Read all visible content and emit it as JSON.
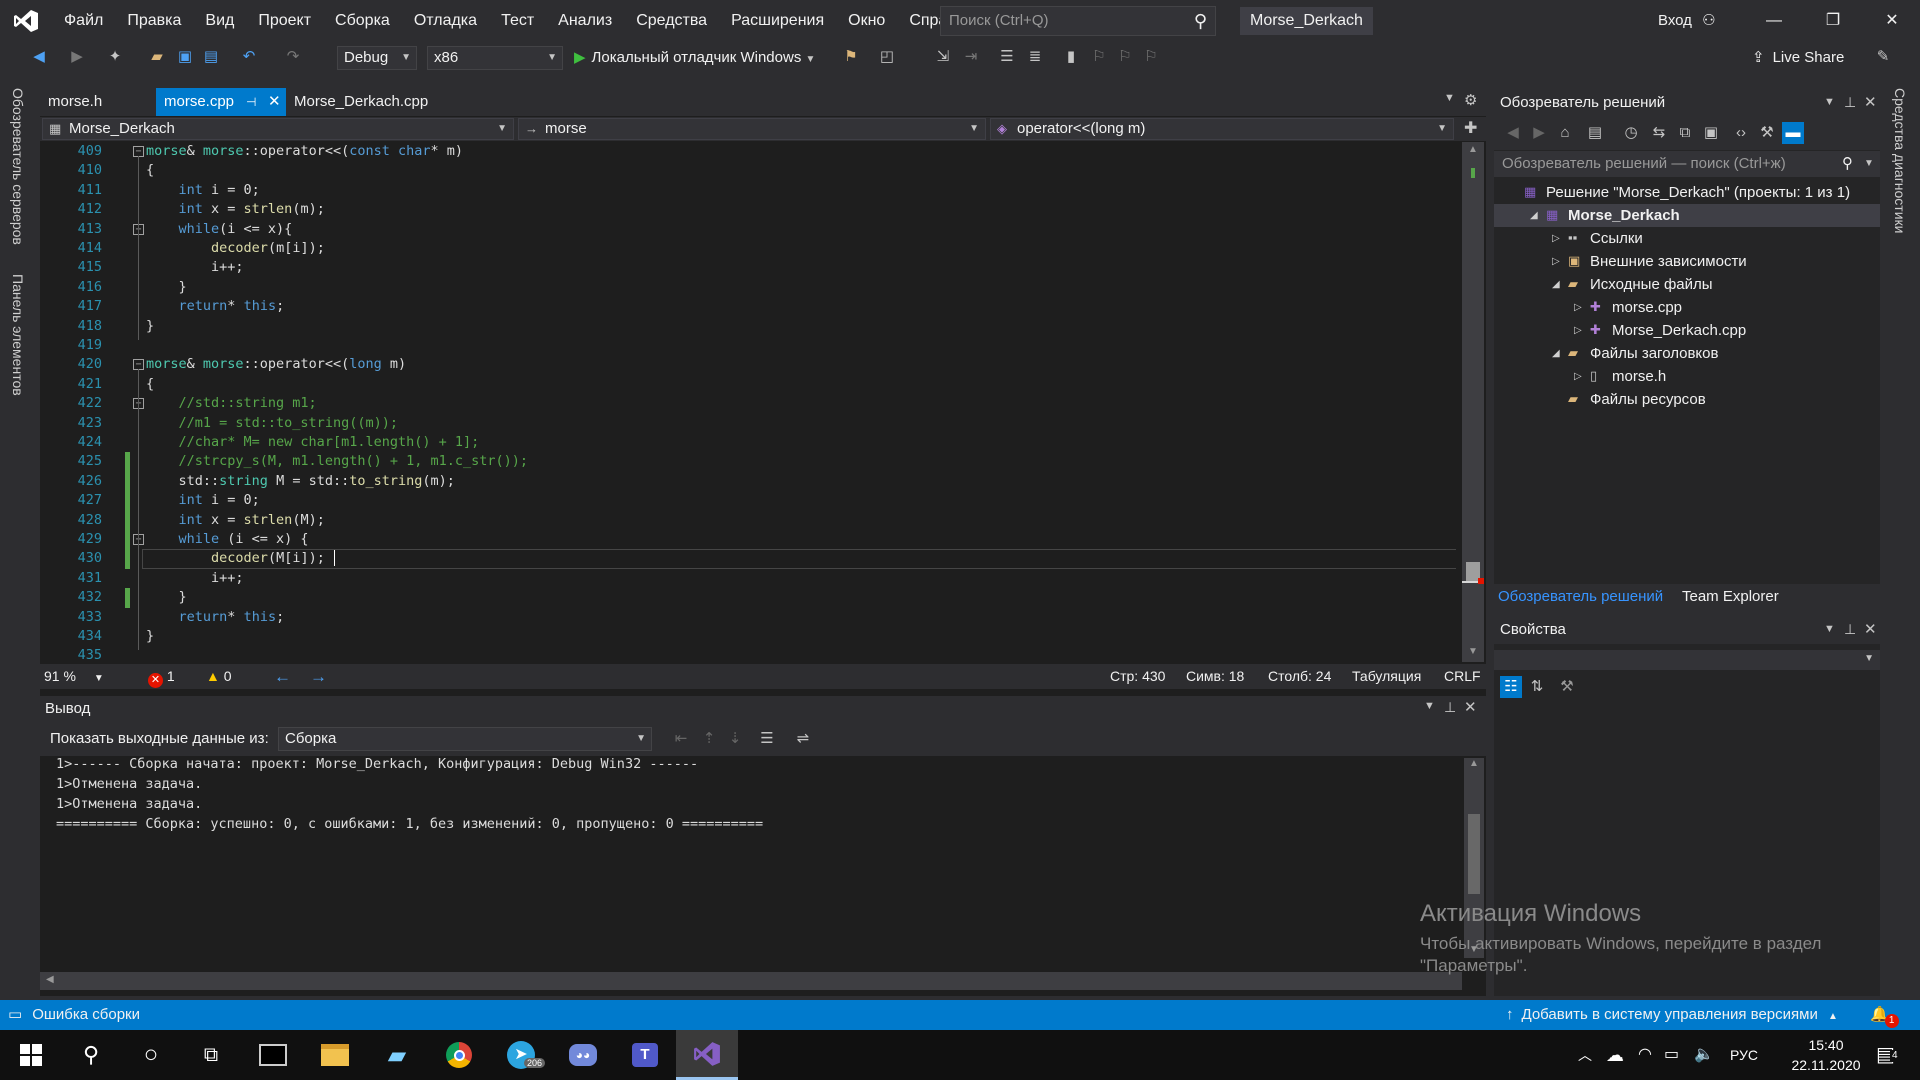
{
  "window": {
    "solution_title": "Morse_Derkach",
    "search_placeholder": "Поиск (Ctrl+Q)",
    "signin": "Вход",
    "menu": [
      "Файл",
      "Правка",
      "Вид",
      "Проект",
      "Сборка",
      "Отладка",
      "Тест",
      "Анализ",
      "Средства",
      "Расширения",
      "Окно",
      "Справка"
    ]
  },
  "toolbar": {
    "config": "Debug",
    "platform": "x86",
    "run_label": "Локальный отладчик Windows",
    "live_share": "Live Share"
  },
  "side_strips": {
    "left_top": "Обозреватель серверов",
    "left_bottom": "Панель элементов",
    "right_top": "Средства диагностики"
  },
  "editor": {
    "tabs": [
      {
        "label": "morse.h",
        "active": false
      },
      {
        "label": "morse.cpp",
        "active": true
      },
      {
        "label": "Morse_Derkach.cpp",
        "active": false
      }
    ],
    "nav": {
      "project": "Morse_Derkach",
      "scope": "morse",
      "member": "operator<<(long m)"
    },
    "lines": [
      {
        "n": "409",
        "code": "morse& morse::operator<<(const char* m)"
      },
      {
        "n": "410",
        "code": "{"
      },
      {
        "n": "411",
        "code": "    int i = 0;"
      },
      {
        "n": "412",
        "code": "    int x = strlen(m);"
      },
      {
        "n": "413",
        "code": "    while(i <= x){"
      },
      {
        "n": "414",
        "code": "        decoder(m[i]);"
      },
      {
        "n": "415",
        "code": "        i++;"
      },
      {
        "n": "416",
        "code": "    }"
      },
      {
        "n": "417",
        "code": "    return* this;"
      },
      {
        "n": "418",
        "code": "}"
      },
      {
        "n": "419",
        "code": ""
      },
      {
        "n": "420",
        "code": "morse& morse::operator<<(long m)"
      },
      {
        "n": "421",
        "code": "{"
      },
      {
        "n": "422",
        "code": "    //std::string m1;"
      },
      {
        "n": "423",
        "code": "    //m1 = std::to_string((m));"
      },
      {
        "n": "424",
        "code": "    //char* M= new char[m1.length() + 1];"
      },
      {
        "n": "425",
        "code": "    //strcpy_s(M, m1.length() + 1, m1.c_str());"
      },
      {
        "n": "426",
        "code": "    std::string M = std::to_string(m);"
      },
      {
        "n": "427",
        "code": "    int i = 0;"
      },
      {
        "n": "428",
        "code": "    int x = strlen(M);"
      },
      {
        "n": "429",
        "code": "    while (i <= x) {"
      },
      {
        "n": "430",
        "code": "        decoder(M[i]); "
      },
      {
        "n": "431",
        "code": "        i++;"
      },
      {
        "n": "432",
        "code": "    }"
      },
      {
        "n": "433",
        "code": "    return* this;"
      },
      {
        "n": "434",
        "code": "}"
      },
      {
        "n": "435",
        "code": ""
      }
    ],
    "status": {
      "zoom": "91 %",
      "errors": "1",
      "warnings": "0",
      "line": "Стр: 430",
      "char": "Симв: 18",
      "col": "Столб: 24",
      "indent": "Табуляция",
      "eol": "CRLF"
    }
  },
  "output": {
    "title": "Вывод",
    "show_from_label": "Показать выходные данные из:",
    "source": "Сборка",
    "lines": [
      "1>------ Сборка начата: проект: Morse_Derkach, Конфигурация: Debug Win32 ------",
      "1>Отменена задача.",
      "1>Отменена задача.",
      "========== Сборка: успешно: 0, с ошибками: 1, без изменений: 0, пропущено: 0 =========="
    ]
  },
  "solution_explorer": {
    "title": "Обозреватель решений",
    "search_placeholder": "Обозреватель решений — поиск (Ctrl+ж)",
    "tree": [
      {
        "label": "Решение \"Morse_Derkach\" (проекты: 1 из 1)",
        "indent": 0,
        "twisty": "",
        "icon": "solution-icon",
        "selected": false
      },
      {
        "label": "Morse_Derkach",
        "indent": 1,
        "twisty": "down",
        "icon": "project-icon",
        "selected": true
      },
      {
        "label": "Ссылки",
        "indent": 2,
        "twisty": "right",
        "icon": "references-icon",
        "selected": false
      },
      {
        "label": "Внешние зависимости",
        "indent": 2,
        "twisty": "right",
        "icon": "dependencies-icon",
        "selected": false
      },
      {
        "label": "Исходные файлы",
        "indent": 2,
        "twisty": "down",
        "icon": "folder-icon",
        "selected": false
      },
      {
        "label": "morse.cpp",
        "indent": 3,
        "twisty": "right",
        "icon": "cpp-file-icon",
        "selected": false
      },
      {
        "label": "Morse_Derkach.cpp",
        "indent": 3,
        "twisty": "right",
        "icon": "cpp-file-icon",
        "selected": false
      },
      {
        "label": "Файлы заголовков",
        "indent": 2,
        "twisty": "down",
        "icon": "folder-icon",
        "selected": false
      },
      {
        "label": "morse.h",
        "indent": 3,
        "twisty": "right",
        "icon": "header-file-icon",
        "selected": false
      },
      {
        "label": "Файлы ресурсов",
        "indent": 2,
        "twisty": "",
        "icon": "folder-icon",
        "selected": false
      }
    ],
    "bottom_tabs": [
      "Обозреватель решений",
      "Team Explorer"
    ]
  },
  "properties": {
    "title": "Свойства"
  },
  "watermark": {
    "title": "Активация Windows",
    "line1": "Чтобы активировать Windows, перейдите в раздел",
    "line2": "\"Параметры\"."
  },
  "statusbar": {
    "left": "Ошибка сборки",
    "right": "Добавить в систему управления версиями",
    "notifications": "1"
  },
  "taskbar": {
    "telegram_badge": "206",
    "lang": "РУС",
    "time": "15:40",
    "date": "22.11.2020",
    "notif_count": "4"
  },
  "colors": {
    "accent": "#007acc",
    "editor_bg": "#1e1e1e",
    "chrome_bg": "#2d2d30",
    "vs_purple": "#865fc5"
  }
}
